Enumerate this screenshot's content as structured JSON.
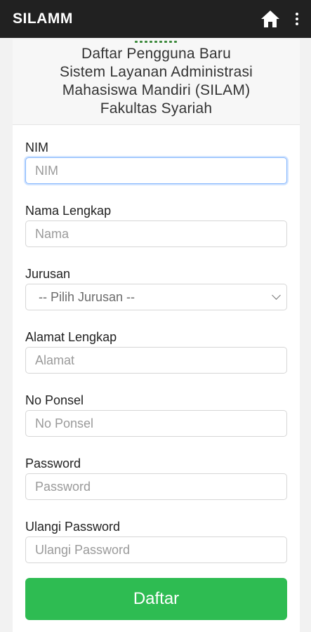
{
  "appbar": {
    "title": "SILAMM",
    "home_icon": "home-icon",
    "menu_icon": "more-vertical-icon"
  },
  "header": {
    "lines": [
      "Daftar Pengguna Baru",
      "Sistem Layanan Administrasi",
      "Mahasiswa Mandiri (SILAM)",
      "Fakultas Syariah"
    ]
  },
  "form": {
    "nim": {
      "label": "NIM",
      "placeholder": "NIM",
      "value": ""
    },
    "nama": {
      "label": "Nama Lengkap",
      "placeholder": "Nama",
      "value": ""
    },
    "jurusan": {
      "label": "Jurusan",
      "selected": "-- Pilih Jurusan --"
    },
    "alamat": {
      "label": "Alamat Lengkap",
      "placeholder": "Alamat",
      "value": ""
    },
    "ponsel": {
      "label": "No Ponsel",
      "placeholder": "No Ponsel",
      "value": ""
    },
    "password": {
      "label": "Password",
      "placeholder": "Password",
      "value": ""
    },
    "ulangi_password": {
      "label": "Ulangi Password",
      "placeholder": "Ulangi Password",
      "value": ""
    },
    "submit_label": "Daftar"
  },
  "colors": {
    "appbar_bg": "#212121",
    "submit_bg": "#2ebc52",
    "focus_border": "#86b7fe"
  }
}
